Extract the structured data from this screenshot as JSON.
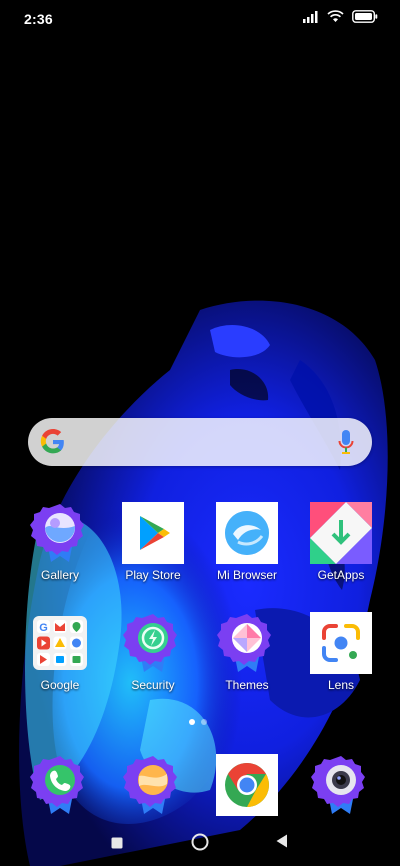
{
  "status_bar": {
    "time": "2:36"
  },
  "search_bar": {
    "brand_icon": "google-g-icon",
    "mic_icon": "microphone-icon"
  },
  "apps": [
    {
      "label": "Gallery",
      "icon": "gallery-icon"
    },
    {
      "label": "Play Store",
      "icon": "play-store-icon"
    },
    {
      "label": "Mi Browser",
      "icon": "mi-browser-icon"
    },
    {
      "label": "GetApps",
      "icon": "getapps-icon"
    },
    {
      "label": "Google",
      "icon": "google-folder-icon"
    },
    {
      "label": "Security",
      "icon": "security-icon"
    },
    {
      "label": "Themes",
      "icon": "themes-icon"
    },
    {
      "label": "Lens",
      "icon": "lens-icon"
    }
  ],
  "dock": [
    {
      "icon": "phone-icon"
    },
    {
      "icon": "messages-icon"
    },
    {
      "icon": "chrome-icon"
    },
    {
      "icon": "camera-icon"
    }
  ],
  "page_indicator": {
    "pages": 2,
    "current": 1
  },
  "nav_bar": {
    "recents": "recents-button",
    "home": "home-button",
    "back": "back-button"
  },
  "colors": {
    "accent_purple": "#7b3ff2",
    "badge_blue": "#2f7df6",
    "wallpaper_blue": "#1f2bff"
  }
}
